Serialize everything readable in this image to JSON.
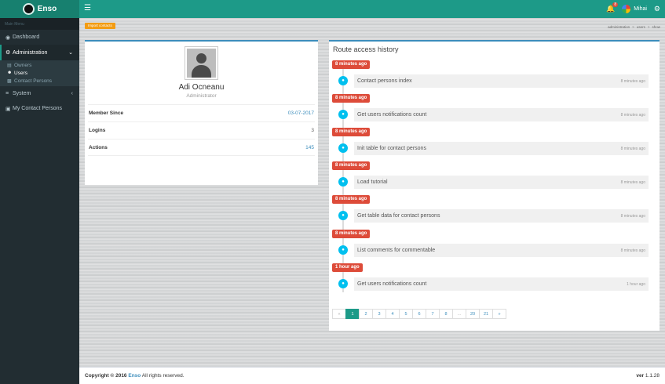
{
  "app": {
    "logo_text": "Enso"
  },
  "topbar": {
    "menu_icon": "hamburger-icon",
    "notifications_count": "8",
    "user_name": "Mihai"
  },
  "sidebar": {
    "header": "Main Menu",
    "items": [
      {
        "label": "Dashboard",
        "icon": "dashboard-icon"
      },
      {
        "label": "Administration",
        "icon": "cogs-icon"
      },
      {
        "label": "System",
        "icon": "sliders-icon"
      },
      {
        "label": "My Contact Persons",
        "icon": "address-book-icon"
      }
    ],
    "admin_sub": [
      {
        "label": "Owners",
        "icon": "table-icon"
      },
      {
        "label": "Users",
        "icon": "users-icon"
      },
      {
        "label": "Contact Persons",
        "icon": "address-card-icon"
      }
    ]
  },
  "header": {
    "import_button": "Import contacts",
    "breadcrumbs": [
      "administration",
      "users",
      "show"
    ]
  },
  "profile": {
    "name": "Adi Ocneanu",
    "role": "Administrator",
    "stats": [
      {
        "label": "Member Since",
        "value": "03-07-2017"
      },
      {
        "label": "Logins",
        "value": "3"
      },
      {
        "label": "Actions",
        "value": "145"
      }
    ]
  },
  "history": {
    "title": "Route access history",
    "entries": [
      {
        "label": "8 minutes ago",
        "text": "Contact persons index",
        "time": "8 minutes ago"
      },
      {
        "label": "8 minutes ago",
        "text": "Get users notifications count",
        "time": "8 minutes ago"
      },
      {
        "label": "8 minutes ago",
        "text": "Init table for contact persons",
        "time": "8 minutes ago"
      },
      {
        "label": "8 minutes ago",
        "text": "Load tutorial",
        "time": "8 minutes ago"
      },
      {
        "label": "8 minutes ago",
        "text": "Get table data for contact persons",
        "time": "8 minutes ago"
      },
      {
        "label": "8 minutes ago",
        "text": "List comments for commentable",
        "time": "8 minutes ago"
      },
      {
        "label": "1 hour ago",
        "text": "Get users notifications count",
        "time": "1 hour ago"
      }
    ],
    "pages": [
      "«",
      "1",
      "2",
      "3",
      "4",
      "5",
      "6",
      "7",
      "8",
      "...",
      "20",
      "21",
      "»"
    ],
    "active_page": "1"
  },
  "footer": {
    "copyright": "Copyright © 2016",
    "brand": "Enso",
    "rights": "All rights reserved.",
    "version_label": "ver",
    "version": "1.1.28"
  }
}
